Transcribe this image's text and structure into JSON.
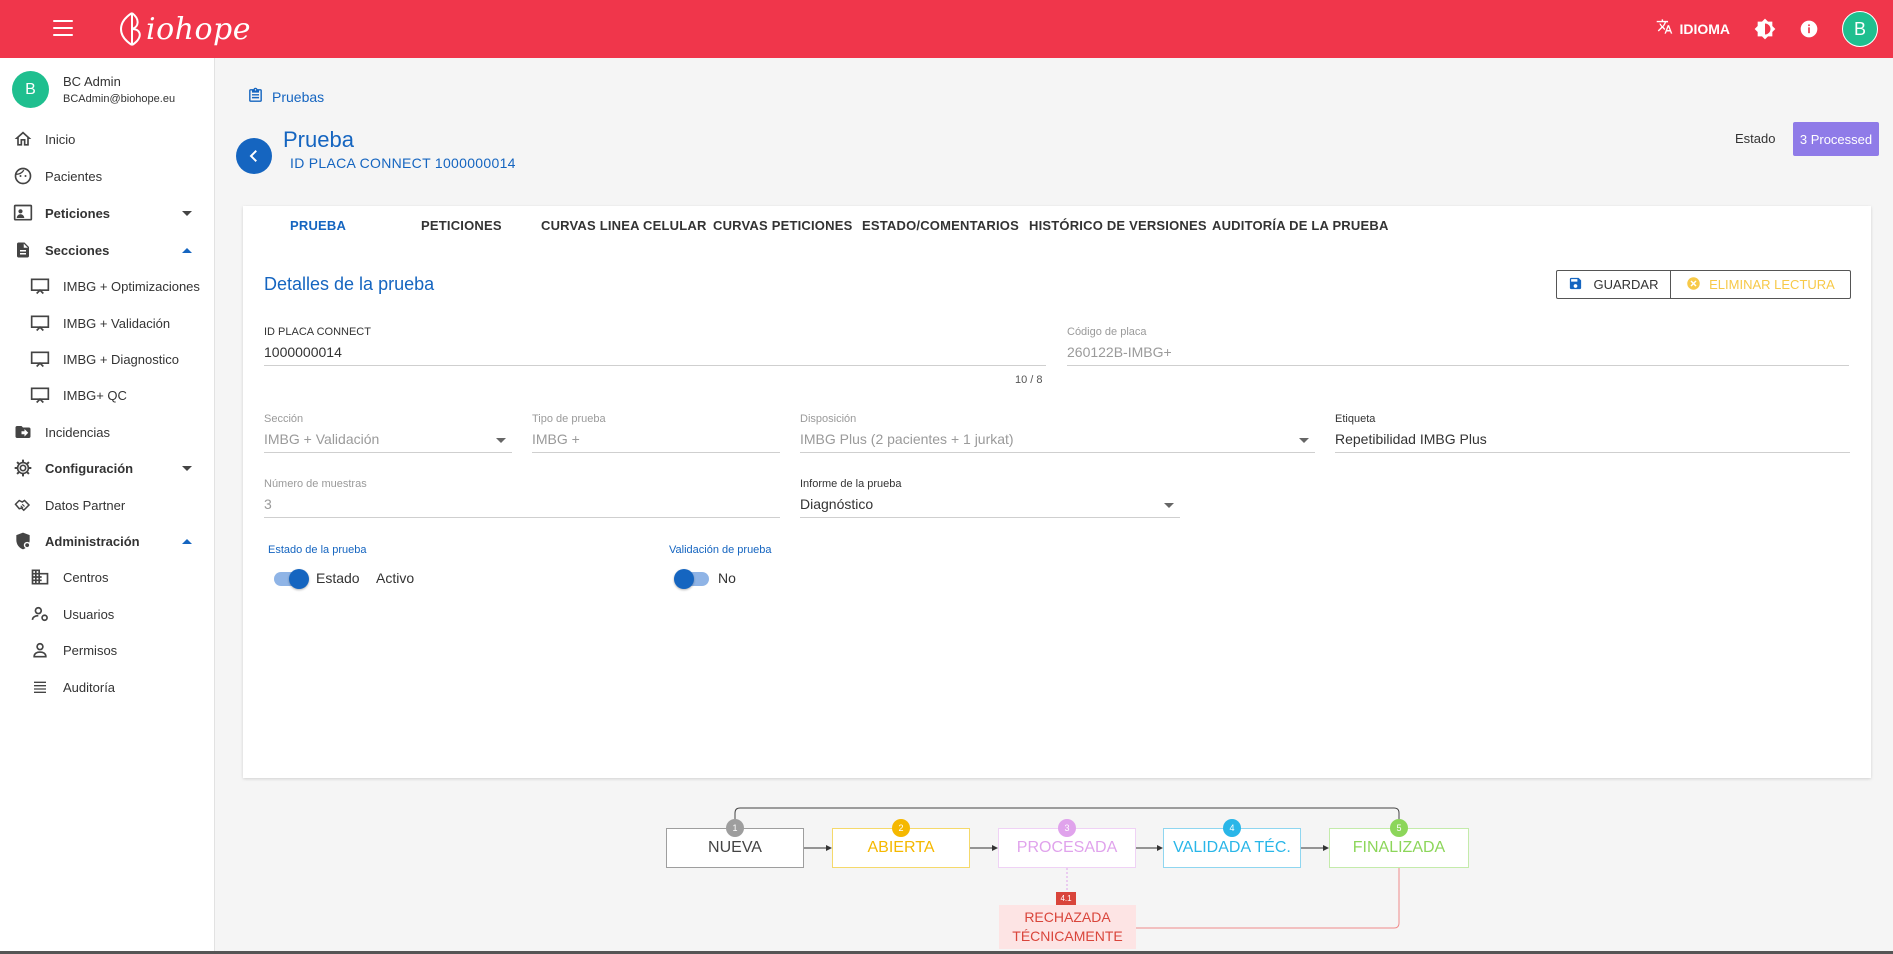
{
  "topbar": {
    "brand": "iohope",
    "language_label": "IDIOMA",
    "user_initial": "B",
    "colors": {
      "bar": "#f0364b",
      "avatar": "#1fbf8f"
    }
  },
  "sidebar": {
    "user": {
      "initial": "B",
      "name": "BC Admin",
      "email": "BCAdmin@biohope.eu"
    },
    "items": {
      "inicio": "Inicio",
      "pacientes": "Pacientes",
      "peticiones": "Peticiones",
      "secciones": "Secciones",
      "imbg_opt": "IMBG + Optimizaciones",
      "imbg_val": "IMBG + Validación",
      "imbg_diag": "IMBG + Diagnostico",
      "imbg_qc": "IMBG+ QC",
      "incidencias": "Incidencias",
      "configuracion": "Configuración",
      "datos_partner": "Datos Partner",
      "administracion": "Administración",
      "centros": "Centros",
      "usuarios": "Usuarios",
      "permisos": "Permisos",
      "auditoria": "Auditoría"
    }
  },
  "breadcrumb": {
    "label": "Pruebas"
  },
  "header": {
    "title": "Prueba",
    "subtitle": "ID PLACA CONNECT 1000000014",
    "estado_label": "Estado",
    "estado_value": "3 Processed",
    "estado_color": "#8f7be8"
  },
  "tabs": {
    "prueba": "PRUEBA",
    "peticiones": "PETICIONES",
    "curvas_linea": "CURVAS LINEA CELULAR",
    "curvas_peticiones": "CURVAS PETICIONES",
    "estado": "ESTADO/COMENTARIOS",
    "historico": "HISTÓRICO DE VERSIONES",
    "auditoria": "AUDITORÍA DE LA PRUEBA"
  },
  "details": {
    "title": "Detalles de la prueba",
    "save_label": "GUARDAR",
    "delete_label": "ELIMINAR LECTURA",
    "fields": {
      "id_placa": {
        "label": "ID PLACA CONNECT",
        "value": "1000000014",
        "counter": "10 / 8"
      },
      "codigo_placa": {
        "label": "Código de placa",
        "value": "260122B-IMBG+"
      },
      "seccion": {
        "label": "Sección",
        "value": "IMBG + Validación"
      },
      "tipo_prueba": {
        "label": "Tipo de prueba",
        "value": "IMBG +"
      },
      "disposicion": {
        "label": "Disposición",
        "value": "IMBG Plus (2 pacientes + 1 jurkat)"
      },
      "etiqueta": {
        "label": "Etiqueta",
        "value": "Repetibilidad IMBG Plus"
      },
      "num_muestras": {
        "label": "Número de muestras",
        "value": "3"
      },
      "informe": {
        "label": "Informe de la prueba",
        "value": "Diagnóstico"
      }
    },
    "toggles": {
      "estado_prueba": {
        "label": "Estado de la prueba",
        "text": "Estado",
        "value": "Activo",
        "on": true
      },
      "validacion": {
        "label": "Validación de prueba",
        "value": "No",
        "on": false
      }
    }
  },
  "workflow": {
    "steps": [
      {
        "num": "1",
        "label": "NUEVA",
        "color": "#9e9e9e"
      },
      {
        "num": "2",
        "label": "ABIERTA",
        "color": "#f5b800"
      },
      {
        "num": "3",
        "label": "PROCESADA",
        "color": "#e0a3ec"
      },
      {
        "num": "4",
        "label": "VALIDADA TÉC.",
        "color": "#29b6e8"
      },
      {
        "num": "5",
        "label": "FINALIZADA",
        "color": "#8cd65a"
      }
    ],
    "rejected": {
      "num": "4.1",
      "line1": "RECHAZADA",
      "line2": "TÉCNICAMENTE",
      "color": "#d9453b"
    }
  }
}
